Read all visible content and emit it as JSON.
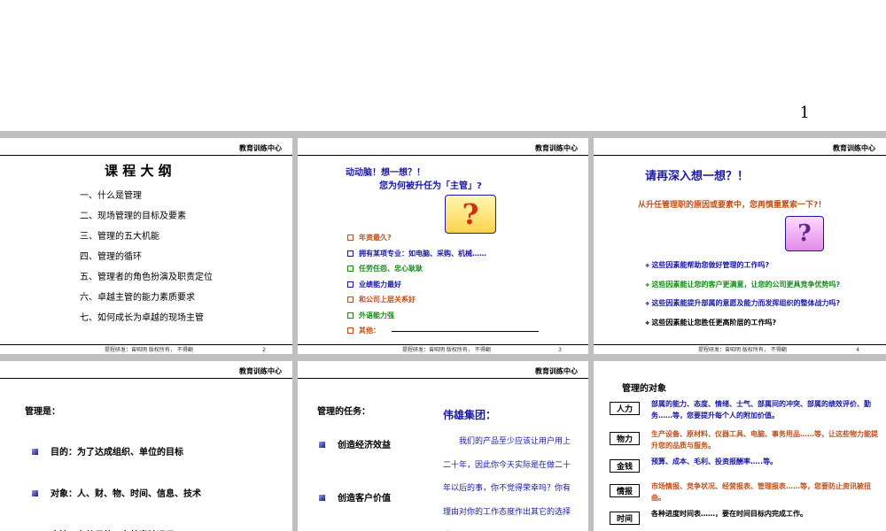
{
  "slide1": {
    "page_number": "1"
  },
  "header": "教育训练中心",
  "footer": "提程研发：曾昭明  版权所有，  不得翻",
  "slide2": {
    "title": "课 程 大 纲",
    "items": [
      "一、什么是管理",
      "二、现场管理的目标及要素",
      "三、管理的五大机能",
      "四、管理的循环",
      "五、管理者的角色扮演及职责定位",
      "六、卓越主管的能力素质要求",
      "七、如何成长为卓越的现场主管"
    ],
    "page": "2"
  },
  "slide3": {
    "line1": "动动脑！想一想？！",
    "line2": "您为何被升任为「主管」?",
    "items": [
      {
        "text": "年资最久?",
        "color": "#c0501a"
      },
      {
        "text": "拥有某项专业：如电脑、采购、机械……",
        "color": "#1a1aa0"
      },
      {
        "text": "任劳任怨、忠心耿耿",
        "color": "#1a8a1a"
      },
      {
        "text": "业绩能力最好",
        "color": "#1a1aa0"
      },
      {
        "text": "和公司上层关系好",
        "color": "#c0501a"
      },
      {
        "text": "外语能力强",
        "color": "#1a8a1a"
      },
      {
        "text": "其他：",
        "color": "#c0501a"
      }
    ],
    "page": "3"
  },
  "slide4": {
    "title": "请再深入想一想？！",
    "subtitle": "从升任管理职的原因或要素中，您再慎重累索一下?！",
    "items": [
      {
        "text": "这些因素能帮助您做好管理的工作吗?",
        "color": "#1a1aa0"
      },
      {
        "text": "这些因素能让您的客户更满意，让您的公司更具竞争优势吗?",
        "color": "#1a8a1a"
      },
      {
        "text": "这些因素能提升部属的意愿及能力而发挥组织的整体战力吗?",
        "color": "#1a1aa0"
      },
      {
        "text": "这些因素能让您胜任更高阶层的工作吗?",
        "color": "#000000"
      }
    ],
    "page": "4"
  },
  "slide5": {
    "title": "管理是：",
    "items": [
      "目的：为了达成组织、单位的目标",
      "对象：人、财、物、时间、信息、技术",
      "方法：有效果的、有效率地运用"
    ]
  },
  "slide6": {
    "title": "管理的任务：",
    "items": [
      "创造经济效益",
      "创造客户价值"
    ],
    "box_title": "伟雄集团：",
    "box_text": "我们的产品至少应该让用户用上二十年，因此你今天实际是在做二十年以后的事，你不觉得荣幸吗？你有理由对你的工作态度作出其它的选择吗?"
  },
  "slide7": {
    "title": "管理的对象",
    "rows": [
      {
        "tag": "人力",
        "text": "部属的能力、态度、情绪、士气、部属间的冲突、部属的绩效评价、勤务……等，您要提升每个人的附加价值。",
        "color": "#1a1aa0"
      },
      {
        "tag": "物力",
        "text": "生产设备、原材料、仪器工具、电脑、事务用品……等，让这些物力能提升您的品质与服务。",
        "color": "#c0501a"
      },
      {
        "tag": "金钱",
        "text": "预算、成本、毛利、投资报酬率…..等。",
        "color": "#1a1aa0"
      },
      {
        "tag": "情报",
        "text": "市场情报、竞争状况、经营报表、管理报表……等，您要防止资讯被扭曲。",
        "color": "#c0501a"
      },
      {
        "tag": "时间",
        "text": "各种进度时间表……，要在时间目标内完成工作。",
        "color": "#000000"
      }
    ]
  }
}
